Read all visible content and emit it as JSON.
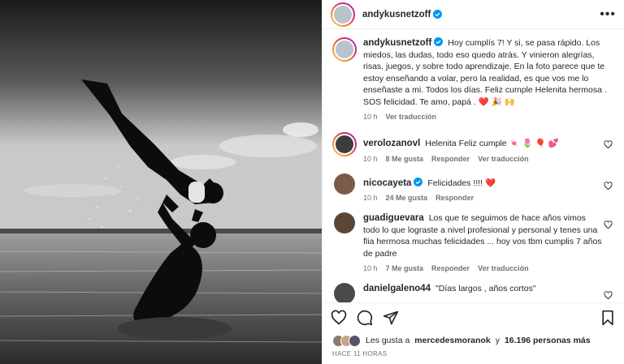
{
  "post": {
    "author": "andykusnetzoff",
    "more_label": "•••"
  },
  "caption": {
    "author": "andykusnetzoff",
    "text": "Hoy cumplís 7! Y si, se pasa rápido. Los miedos, las dudas, todo eso quedo atrás. Y vinieron alegrías, risas, juegos, y sobre todo aprendizaje. En la foto parece que te estoy enseñando a volar, pero la realidad, es que vos me lo enseñaste a mi. Todos los días. Feliz cumple Helenita hermosa . SOS felicidad. Te amo, papá . ❤️ 🎉 🙌",
    "time": "10 h",
    "translate": "Ver traducción"
  },
  "comments": [
    {
      "author": "verolozanovl",
      "text": "Helenita Feliz cumple 🍬 🌷 🎈 💕",
      "time": "10 h",
      "likes": "8 Me gusta",
      "reply": "Responder",
      "translate": "Ver traducción"
    },
    {
      "author": "nicocayeta",
      "text": "Felicidades !!!! ❤️",
      "time": "10 h",
      "likes": "24 Me gusta",
      "reply": "Responder",
      "translate": ""
    },
    {
      "author": "guadiguevara",
      "text": "Los que te seguimos de hace años vimos todo lo que lograste a nivel profesional y personal y tenes una flia hermosa muchas felicidades ... hoy vos tbm cumplis 7 años de padre",
      "time": "10 h",
      "likes": "7 Me gusta",
      "reply": "Responder",
      "translate": "Ver traducción"
    },
    {
      "author": "danielgaleno44",
      "text": "\"Días largos , años cortos\"",
      "time": "",
      "likes": "",
      "reply": "",
      "translate": ""
    }
  ],
  "likes": {
    "prefix": "Les gusta a",
    "user": "mercedesmoranok",
    "middle": "y",
    "count": "16.196 personas más"
  },
  "timestamp": "HACE 11 HORAS",
  "icons": {
    "like": "heart-icon",
    "comment": "comment-icon",
    "share": "share-icon",
    "save": "bookmark-icon",
    "verified": "verified-badge-icon"
  },
  "colors": {
    "verified": "#0095f6",
    "meta": "#737373",
    "text": "#262626"
  }
}
